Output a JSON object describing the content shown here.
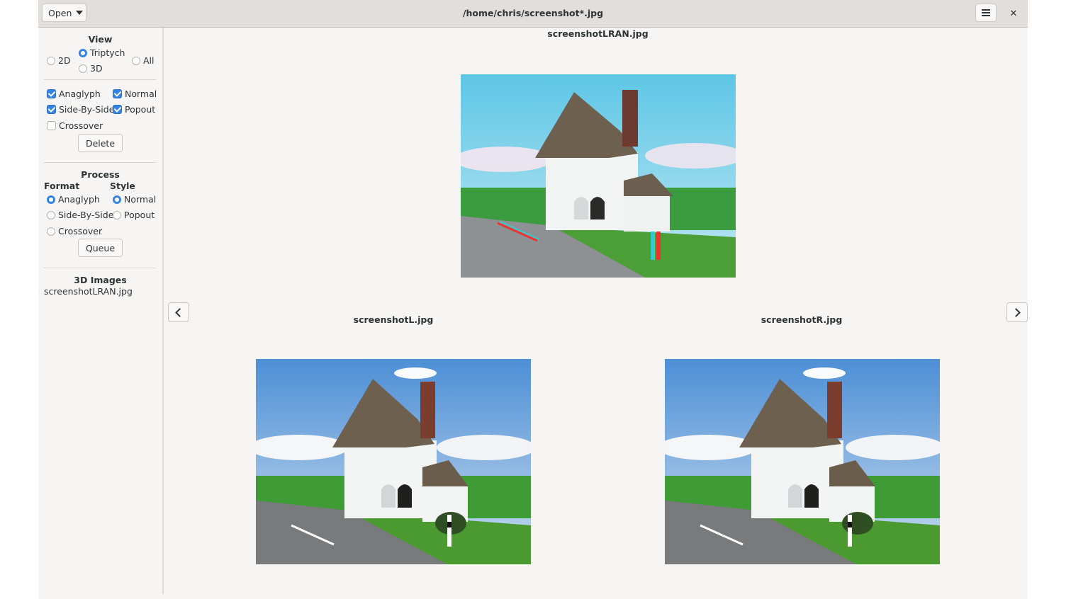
{
  "header": {
    "open_label": "Open",
    "title": "/home/chris/screenshot*.jpg",
    "menu_icon": "hamburger-menu-icon",
    "close_icon": "close-icon"
  },
  "sidebar": {
    "view": {
      "title": "View",
      "options": [
        {
          "label": "2D",
          "selected": false
        },
        {
          "label": "Triptych",
          "selected": true
        },
        {
          "label": "3D",
          "selected": false
        },
        {
          "label": "All",
          "selected": false
        }
      ]
    },
    "filters": [
      {
        "label": "Anaglyph",
        "checked": true
      },
      {
        "label": "Normal",
        "checked": true
      },
      {
        "label": "Side-By-Side",
        "checked": true
      },
      {
        "label": "Popout",
        "checked": true
      },
      {
        "label": "Crossover",
        "checked": false
      }
    ],
    "delete_label": "Delete",
    "process": {
      "title": "Process",
      "format_label": "Format",
      "style_label": "Style",
      "formats": [
        {
          "label": "Anaglyph",
          "selected": true
        },
        {
          "label": "Side-By-Side",
          "selected": false
        },
        {
          "label": "Crossover",
          "selected": false
        }
      ],
      "styles": [
        {
          "label": "Normal",
          "selected": true
        },
        {
          "label": "Popout",
          "selected": false
        }
      ],
      "queue_label": "Queue"
    },
    "images_3d": {
      "title": "3D Images",
      "items": [
        "screenshotLRAN.jpg"
      ]
    }
  },
  "main": {
    "top_image": {
      "name": "screenshotLRAN.jpg",
      "type": "anaglyph"
    },
    "left_image": {
      "name": "screenshotL.jpg",
      "type": "normal"
    },
    "right_image": {
      "name": "screenshotR.jpg",
      "type": "normal"
    },
    "prev_icon": "chevron-left-icon",
    "next_icon": "chevron-right-icon"
  }
}
